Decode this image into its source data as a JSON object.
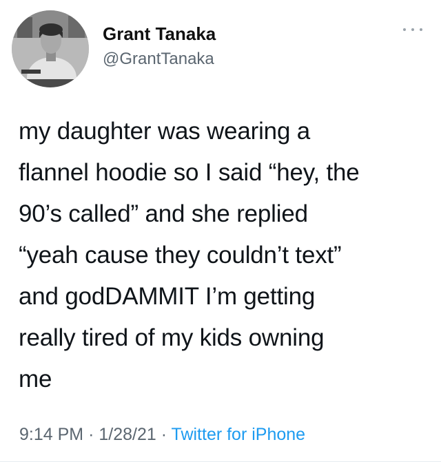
{
  "tweet": {
    "author": {
      "display_name": "Grant Tanaka",
      "handle": "@GrantTanaka",
      "avatar_icon": "portrait-photo-icon"
    },
    "more_icon": "more-dots-icon",
    "text_lines": [
      "my daughter was wearing a",
      "flannel hoodie so I said “hey, the",
      "90’s called” and she replied",
      "“yeah cause they couldn’t text”",
      "and godDAMMIT I’m getting",
      "really tired of my kids owning",
      "me"
    ],
    "time": "9:14 PM",
    "separator": "·",
    "date": "1/28/21",
    "source": "Twitter for iPhone",
    "colors": {
      "text": "#0f1419",
      "muted": "#5b6670",
      "link": "#1d9bf0"
    }
  }
}
